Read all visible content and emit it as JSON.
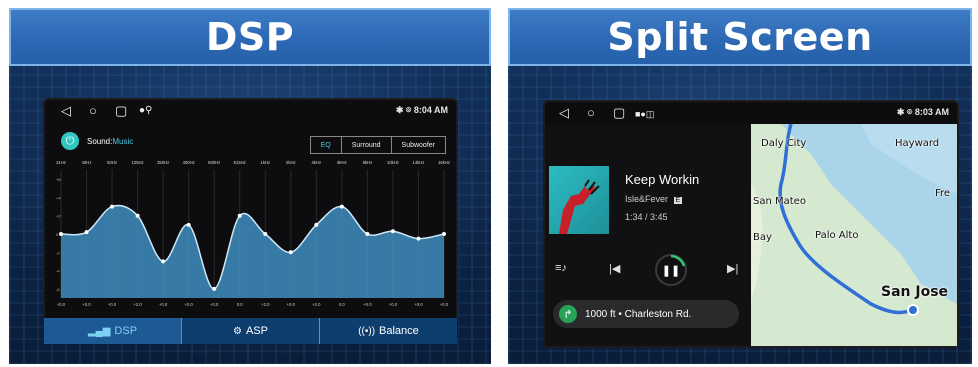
{
  "dsp_panel": {
    "banner_title": "DSP",
    "status_time": "8:04 AM",
    "sound_prefix": "Sound:",
    "sound_source": "Music",
    "tabs": [
      "EQ",
      "Surround",
      "Subwoofer"
    ],
    "eq": {
      "freq_labels": [
        "31Hz",
        "40Hz",
        "50Hz",
        "125Hz",
        "250Hz",
        "400Hz",
        "500Hz",
        "815Hz",
        "1kHz",
        "2kHz",
        "4kHz",
        "6kHz",
        "8kHz",
        "10kHz",
        "14kHz",
        "16kHz"
      ],
      "gain_values": [
        0.0,
        0.2,
        3.0,
        2.0,
        -3.0,
        1.0,
        -6.0,
        2.0,
        0.0,
        -2.0,
        1.0,
        3.0,
        0.0,
        0.3,
        -0.5,
        0.0
      ],
      "value_labels": [
        "+0.0",
        "+0.0",
        "+0.0",
        "+2.0",
        "+0.0",
        "+0.0",
        "+0.0",
        "0.0",
        "+2.0",
        "+0.0",
        "+2.0",
        "0.0",
        "+0.0",
        "+0.0",
        "+0.0",
        "+0.0"
      ],
      "y_ticks": [
        "+6",
        "+4",
        "+2",
        "0",
        "-2",
        "-4",
        "-6"
      ],
      "y_range": [
        -7,
        7
      ]
    },
    "bottom_tabs": [
      {
        "icon": "bars-icon",
        "label": "DSP"
      },
      {
        "icon": "asp-icon",
        "label": "ASP"
      },
      {
        "icon": "balance-icon",
        "label": "Balance"
      }
    ]
  },
  "split_panel": {
    "banner_title": "Split Screen",
    "status_time": "8:03 AM",
    "song": {
      "title": "Keep Workin",
      "artist": "Isle&Fever",
      "explicit": "E",
      "time": "1:34 / 3:45"
    },
    "navigation": "1000 ft • Charleston Rd.",
    "map_labels": {
      "daly_city": "Daly City",
      "hayward": "Hayward",
      "san_mateo": "San Mateo",
      "fre": "Fre",
      "bay": "Bay",
      "palo_alto": "Palo Alto",
      "san_jose": "San Jose"
    }
  },
  "colors": {
    "banner": "#2d68b4",
    "accent": "#4ec9e6",
    "eq_fill": "#3f8ec0",
    "route": "#2f6fd6"
  }
}
